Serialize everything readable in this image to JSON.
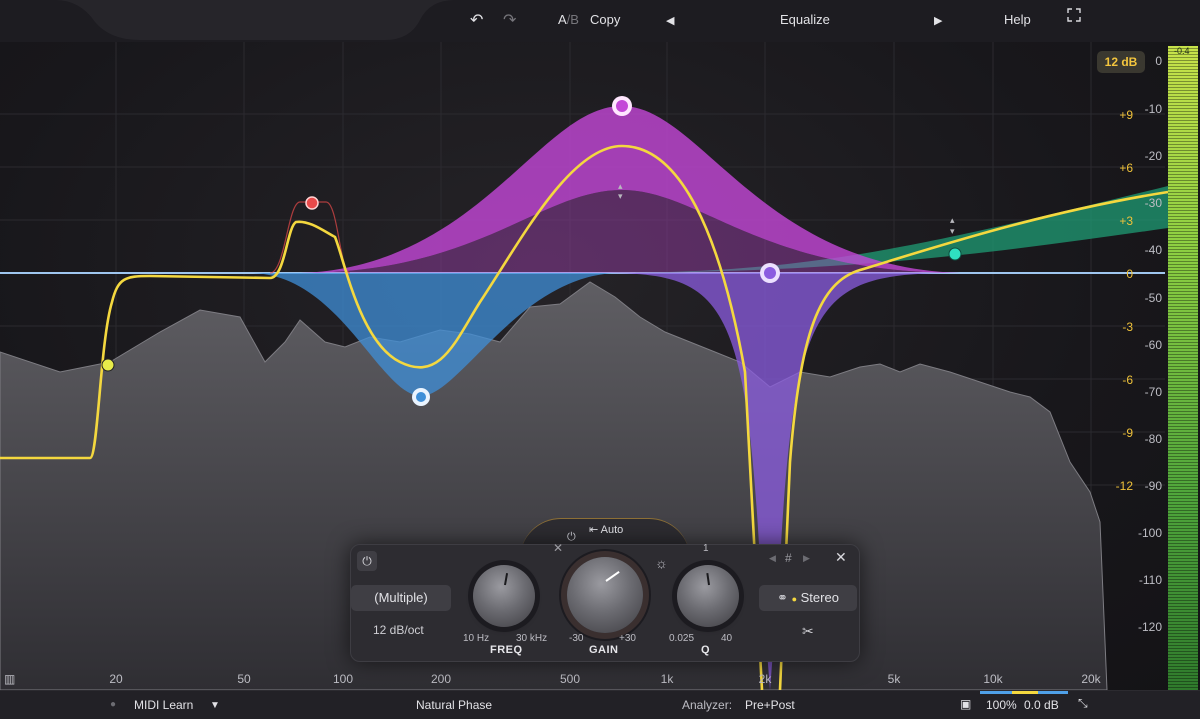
{
  "topbar": {
    "undo_icon": "undo-icon",
    "redo_icon": "redo-icon",
    "ab_a": "A",
    "ab_sep": "/",
    "ab_b": "B",
    "copy_label": "Copy",
    "prev_icon": "triangle-left-icon",
    "preset_name": "Equalize",
    "next_icon": "triangle-right-icon",
    "help_label": "Help",
    "fullscreen_icon": "fullscreen-icon"
  },
  "display": {
    "range_badge": "12 dB",
    "meter_peak": "-0.4",
    "gain_scale": [
      "+9",
      "+6",
      "+3",
      "0",
      "-3",
      "-6",
      "-9",
      "-12"
    ],
    "db_scale": [
      "0",
      "-10",
      "-20",
      "-30",
      "-40",
      "-50",
      "-60",
      "-70",
      "-80",
      "-90",
      "-100",
      "-110",
      "-120"
    ],
    "freq_scale": [
      "20",
      "50",
      "100",
      "200",
      "500",
      "1k",
      "2k",
      "5k",
      "10k",
      "20k"
    ],
    "colors": {
      "eq_curve": "#f4d83f",
      "band_purple": "#c447d8",
      "band_blue": "#3f8fd8",
      "band_violet": "#8b5ce0",
      "band_green": "#1f9c74",
      "band_red": "#e84a4a"
    }
  },
  "band_panel": {
    "power_icon": "power-icon",
    "filter_type": "(Multiple)",
    "slope": "12 dB/oct",
    "freq": {
      "name": "FREQ",
      "min": "10 Hz",
      "max": "30 kHz"
    },
    "gain": {
      "name": "GAIN",
      "min": "-30",
      "max": "+30"
    },
    "q": {
      "name": "Q",
      "min": "0.025",
      "max": "40",
      "top": "1"
    },
    "auto_label": "Auto",
    "close_icon": "close-icon",
    "hash": "#",
    "stereo_label": "Stereo",
    "scissors_icon": "scissors-icon"
  },
  "bottombar": {
    "midi_learn": "MIDI Learn",
    "phase_mode": "Natural Phase",
    "analyzer_label": "Analyzer:",
    "analyzer_value": "Pre+Post",
    "zoom": "100%",
    "output_gain": "0.0 dB"
  }
}
